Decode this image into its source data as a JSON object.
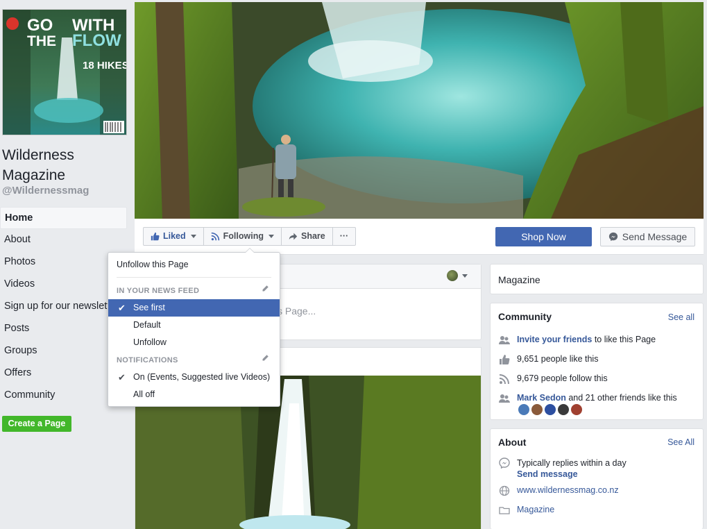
{
  "profile": {
    "magazine_word": "WITH",
    "magazine_go": "GO",
    "magazine_the": "THE",
    "magazine_flow": "FLOW",
    "magazine_hikes": "18 HIKES",
    "page_name": "Wilderness Magazine",
    "handle": "@Wildernessmag"
  },
  "nav": {
    "items": [
      {
        "label": "Home",
        "active": true
      },
      {
        "label": "About"
      },
      {
        "label": "Photos"
      },
      {
        "label": "Videos"
      },
      {
        "label": "Sign up for our newsletter"
      },
      {
        "label": "Posts"
      },
      {
        "label": "Groups"
      },
      {
        "label": "Offers"
      },
      {
        "label": "Community"
      }
    ],
    "create_page": "Create a Page"
  },
  "actions": {
    "liked": "Liked",
    "following": "Following",
    "share": "Share",
    "more": "···",
    "shop_now": "Shop Now",
    "send_message": "Send Message"
  },
  "composer": {
    "placeholder": "s Page..."
  },
  "dropdown": {
    "unfollow_page": "Unfollow this Page",
    "news_feed_header": "IN YOUR NEWS FEED",
    "see_first": "See first",
    "default": "Default",
    "unfollow": "Unfollow",
    "notifications_header": "NOTIFICATIONS",
    "on": "On (Events, Suggested live Videos)",
    "all_off": "All off"
  },
  "right": {
    "category": "Magazine",
    "community": {
      "title": "Community",
      "see_all": "See all",
      "invite_link": "Invite your friends",
      "invite_rest": " to like this Page",
      "likes": "9,651 people like this",
      "follows": "9,679 people follow this",
      "friend_link": "Mark Sedon",
      "friend_rest": " and 21 other friends like this"
    },
    "about": {
      "title": "About",
      "see_all": "See All",
      "replies": "Typically replies within a day",
      "send_message": "Send message",
      "website": "www.wildernessmag.co.nz",
      "category": "Magazine"
    }
  },
  "colors": {
    "fb_blue": "#4267b2",
    "link_blue": "#365899",
    "green": "#42b72a"
  }
}
